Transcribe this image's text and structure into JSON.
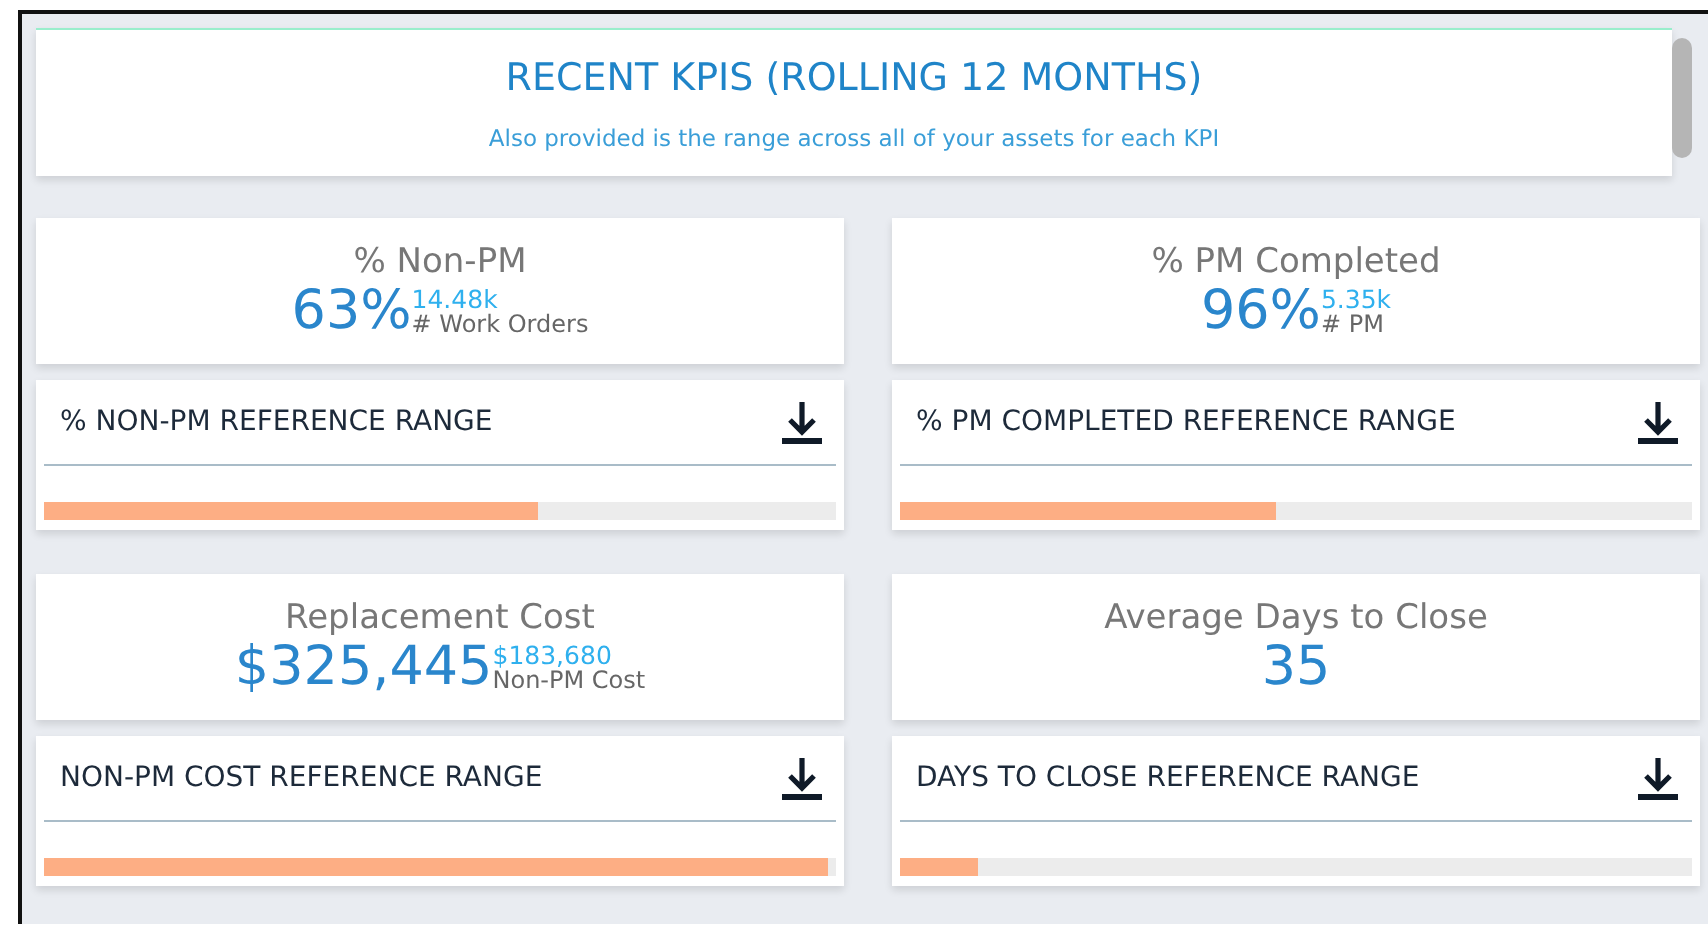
{
  "header": {
    "title": "RECENT KPIS (ROLLING 12 MONTHS)",
    "subtitle": "Also provided is the range across all of your assets for each KPI"
  },
  "kpis": [
    {
      "label": "% Non-PM",
      "value": "63%",
      "sub_value": "14.48k",
      "sub_label": "# Work Orders",
      "range_title": "% NON-PM REFERENCE RANGE",
      "level": 0.63
    },
    {
      "label": "% PM Completed",
      "value": "96%",
      "sub_value": "5.35k",
      "sub_label": "# PM",
      "range_title": "% PM COMPLETED REFERENCE RANGE",
      "level": 0.48
    },
    {
      "label": "Replacement Cost",
      "value": "$325,445",
      "sub_value": "$183,680",
      "sub_label": "Non-PM Cost",
      "range_title": "NON-PM COST REFERENCE RANGE",
      "level": 1.0
    },
    {
      "label": "Average Days to Close",
      "value": "35",
      "range_title": "DAYS TO CLOSE REFERENCE RANGE",
      "level": 0.1
    }
  ]
}
